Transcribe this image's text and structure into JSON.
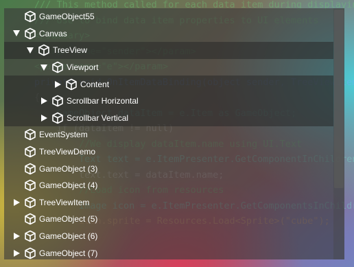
{
  "background_code": [
    {
      "kind": "cm",
      "text": "/// This method called for each data item during displaying"
    },
    {
      "kind": "cm",
      "text": "/// Use to bind data item properties to UI elements"
    },
    {
      "kind": "cm",
      "text": "</summary>"
    },
    {
      "kind": "cm",
      "text": "<param name=\"sender\"></param>"
    },
    {
      "kind": "cm",
      "text": "<param name=\"e\"></param>"
    },
    {
      "kind": "kw",
      "text": "private void OnItemDataBinding(object sender, TreeViewItemDataBind"
    },
    {
      "kind": "tx",
      "text": "{"
    },
    {
      "kind": "ty",
      "text": "    GameObject dataItem = e.Item as GameObject;"
    },
    {
      "kind": "tx",
      "text": "    if (dataItem != null)"
    },
    {
      "kind": "tx",
      "text": ""
    },
    {
      "kind": "cm",
      "text": "        //We display dataItem.name using UI.Text"
    },
    {
      "kind": "ty",
      "text": "        Text text = e.ItemPresenter.GetComponentInChildren<Text>("
    },
    {
      "kind": "tx",
      "text": "        text.text = dataItem.name;"
    },
    {
      "kind": "tx",
      "text": ""
    },
    {
      "kind": "cm",
      "text": "        //Load icon from resources"
    },
    {
      "kind": "ty",
      "text": "        Image icon = e.ItemPresenter.GetComponentsInChildren<Imag"
    },
    {
      "kind": "st",
      "text": "        icon.sprite = Resources.Load<Sprite>(\"cube\");"
    },
    {
      "kind": "tx",
      "text": ""
    }
  ],
  "tree": {
    "items": [
      {
        "label": "GameObject55",
        "depth": 0,
        "toggle": "none",
        "selected": false
      },
      {
        "label": "Canvas",
        "depth": 0,
        "toggle": "expanded",
        "selected": false
      },
      {
        "label": "TreeView",
        "depth": 1,
        "toggle": "expanded",
        "selected": true
      },
      {
        "label": "Viewport",
        "depth": 2,
        "toggle": "expanded",
        "selected": false
      },
      {
        "label": "Content",
        "depth": 3,
        "toggle": "collapsed",
        "selected": true
      },
      {
        "label": "Scrollbar Horizontal",
        "depth": 2,
        "toggle": "collapsed",
        "selected": true
      },
      {
        "label": "Scrollbar Vertical",
        "depth": 2,
        "toggle": "collapsed",
        "selected": true
      },
      {
        "label": "EventSystem",
        "depth": 0,
        "toggle": "none",
        "selected": false
      },
      {
        "label": "TreeViewDemo",
        "depth": 0,
        "toggle": "none",
        "selected": false
      },
      {
        "label": "GameObject (3)",
        "depth": 0,
        "toggle": "none",
        "selected": false
      },
      {
        "label": "GameObject (4)",
        "depth": 0,
        "toggle": "none",
        "selected": false
      },
      {
        "label": "TreeViewItem",
        "depth": 0,
        "toggle": "collapsed",
        "selected": false
      },
      {
        "label": "GameObject (5)",
        "depth": 0,
        "toggle": "none",
        "selected": false
      },
      {
        "label": "GameObject (6)",
        "depth": 0,
        "toggle": "collapsed",
        "selected": false
      },
      {
        "label": "GameObject (7)",
        "depth": 0,
        "toggle": "collapsed",
        "selected": false
      }
    ],
    "icon": "cube-icon"
  },
  "colors": {
    "panel_bg": "#3a3a3a",
    "selected_row": "#282828",
    "text": "#ffffff"
  }
}
